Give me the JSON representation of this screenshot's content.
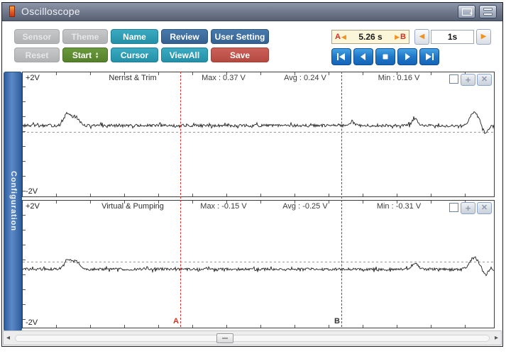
{
  "window": {
    "title": "Oscilloscope"
  },
  "toolbar": {
    "spinner_up": "▴",
    "spinner_down": "▾",
    "buttons": [
      {
        "label": "Sensor",
        "style": "gray"
      },
      {
        "label": "Theme",
        "style": "gray"
      },
      {
        "label": "Name",
        "style": "teal"
      },
      {
        "label": "Review",
        "style": "blue"
      },
      {
        "label": "User Setting",
        "style": "blue"
      },
      {
        "label": "Reset",
        "style": "gray"
      },
      {
        "label": "Start",
        "style": "green"
      },
      {
        "label": "Cursor",
        "style": "teal"
      },
      {
        "label": "ViewAll",
        "style": "teal"
      },
      {
        "label": "Save",
        "style": "red"
      }
    ]
  },
  "time_controls": {
    "a_marker": "A",
    "b_marker": "B",
    "ab_left_arrow": "◀",
    "ab_right_arrow": "▶",
    "ab_interval": "5.26 s",
    "step_left_arrow": "◀",
    "step_right_arrow": "▶",
    "step_interval": "1s"
  },
  "playback": {
    "buttons": [
      "skip-start",
      "step-back",
      "stop",
      "play",
      "skip-end"
    ]
  },
  "sidebar": {
    "label": "Configuration"
  },
  "panels": [
    {
      "y_top": "+2V",
      "y_bottom": "-2V",
      "title": "Nernst & Trim",
      "max": "Max : 0.37 V",
      "avg": "Avg : 0.24 V",
      "min": "Min : 0.16 V"
    },
    {
      "y_top": "+2V",
      "y_bottom": "-2V",
      "title": "Virtual & Pumping",
      "max": "Max : -0.15 V",
      "avg": "Avg : -0.25 V",
      "min": "Min : -0.31 V"
    }
  ],
  "cursors": {
    "a": {
      "label": "A",
      "color": "#e03434"
    },
    "b": {
      "label": "B",
      "color": "#555555"
    }
  },
  "scrollbar": {
    "left_arrow": "◂",
    "right_arrow": "▸"
  },
  "colors": {
    "titlebar": "#6d7789",
    "teal_button": "#2d9db5",
    "blue_button": "#3a6a9e",
    "green_button": "#5e8d33",
    "red_button": "#c05248",
    "gray_button": "#bcbcbe",
    "playback_blue": "#2077c8",
    "accent_orange": "#f0921e",
    "marker_red": "#d22f1e",
    "ab_box_bg": "#fbf5da",
    "config_bar": "#3f6fae",
    "trace": "#222222"
  },
  "chart_data": [
    {
      "type": "line",
      "title": "Nernst & Trim",
      "ylim": [
        -2,
        2
      ],
      "y_top_label": "+2V",
      "y_bottom_label": "-2V",
      "stats": {
        "max_v": 0.37,
        "avg_v": 0.24,
        "min_v": 0.16
      },
      "zero_line": true,
      "baseline_v": 0.24,
      "noise_v": 0.05,
      "seed": 13,
      "bumps": [
        {
          "x_frac": 0.095,
          "peak_v": 0.68,
          "width_frac": 0.007
        },
        {
          "x_frac": 0.113,
          "peak_v": 0.55,
          "width_frac": 0.007
        },
        {
          "x_frac": 0.7,
          "peak_v": 0.4,
          "width_frac": 0.004
        },
        {
          "x_frac": 0.832,
          "peak_v": 0.48,
          "width_frac": 0.006
        },
        {
          "x_frac": 0.958,
          "peak_v": 0.72,
          "width_frac": 0.009
        },
        {
          "x_frac": 0.982,
          "peak_v": -0.06,
          "width_frac": 0.005
        }
      ]
    },
    {
      "type": "line",
      "title": "Virtual & Pumping",
      "ylim": [
        -2,
        2
      ],
      "y_top_label": "+2V",
      "y_bottom_label": "-2V",
      "stats": {
        "max_v": -0.15,
        "avg_v": -0.25,
        "min_v": -0.31
      },
      "zero_line": true,
      "baseline_v": -0.25,
      "noise_v": 0.045,
      "seed": 29,
      "bumps": [
        {
          "x_frac": 0.095,
          "peak_v": 0.1,
          "width_frac": 0.007
        },
        {
          "x_frac": 0.113,
          "peak_v": 0.02,
          "width_frac": 0.007
        },
        {
          "x_frac": 0.832,
          "peak_v": -0.02,
          "width_frac": 0.006
        },
        {
          "x_frac": 0.958,
          "peak_v": 0.16,
          "width_frac": 0.009
        },
        {
          "x_frac": 0.982,
          "peak_v": -0.45,
          "width_frac": 0.005
        }
      ]
    }
  ]
}
